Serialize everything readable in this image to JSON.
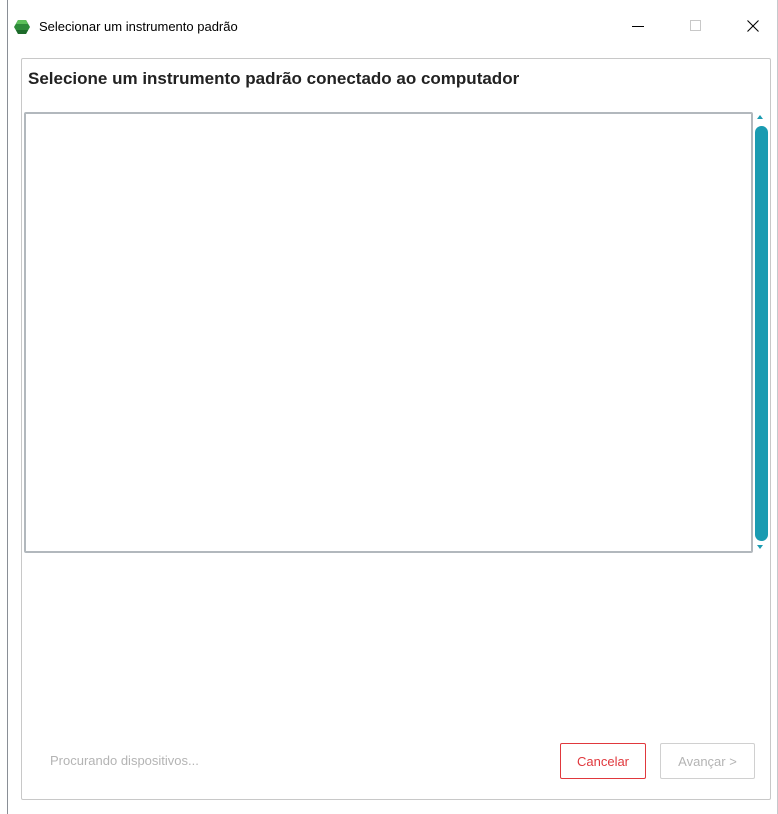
{
  "window": {
    "title": "Selecionar um instrumento padrão",
    "controls": {
      "minimize_icon": "minimize-icon",
      "maximize_icon": "maximize-icon",
      "close_icon": "close-icon"
    }
  },
  "dialog": {
    "heading": "Selecione um instrumento padrão conectado ao computador",
    "device_list": {
      "items": [],
      "scrollbar_color": "#1a9bb1"
    },
    "status": "Procurando dispositivos...",
    "buttons": {
      "cancel_label": "Cancelar",
      "next_label": "Avançar >"
    }
  },
  "colors": {
    "accent": "#1a9bb1",
    "cancel": "#e0383d",
    "disabled_text": "#b4b4b4",
    "app_icon": "#2e8b3a"
  }
}
